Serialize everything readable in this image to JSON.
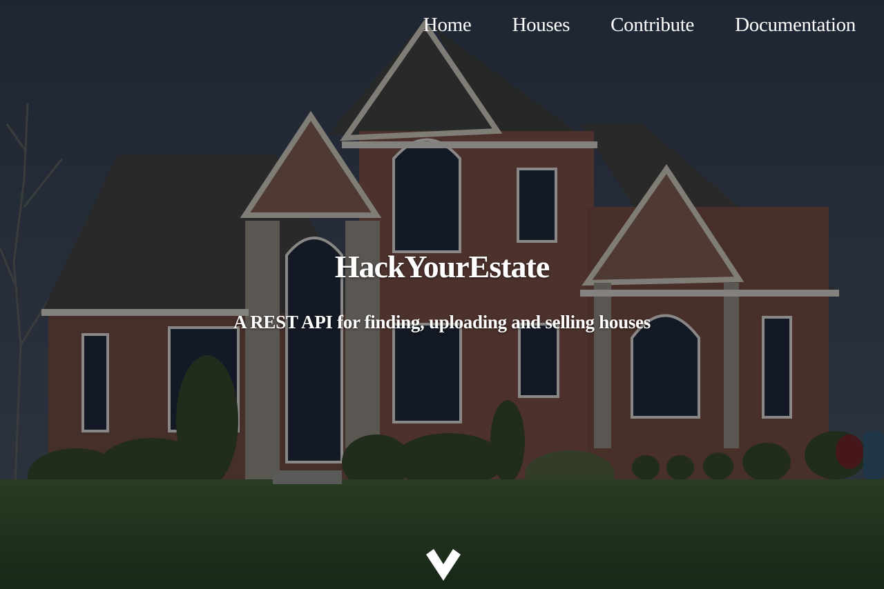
{
  "nav": {
    "items": [
      {
        "label": "Home"
      },
      {
        "label": "Houses"
      },
      {
        "label": "Contribute"
      },
      {
        "label": "Documentation"
      }
    ]
  },
  "hero": {
    "title": "HackYourEstate",
    "subtitle": "A REST API for finding, uploading and selling houses",
    "background": "photo of a brick house with lawn",
    "scroll_icon": "chevron-down-icon"
  },
  "colors": {
    "sky": "#2a3444",
    "brick": "#5a3a31",
    "roof": "#2f302c",
    "lawn": "#2c4a22",
    "text": "#ffffff"
  }
}
